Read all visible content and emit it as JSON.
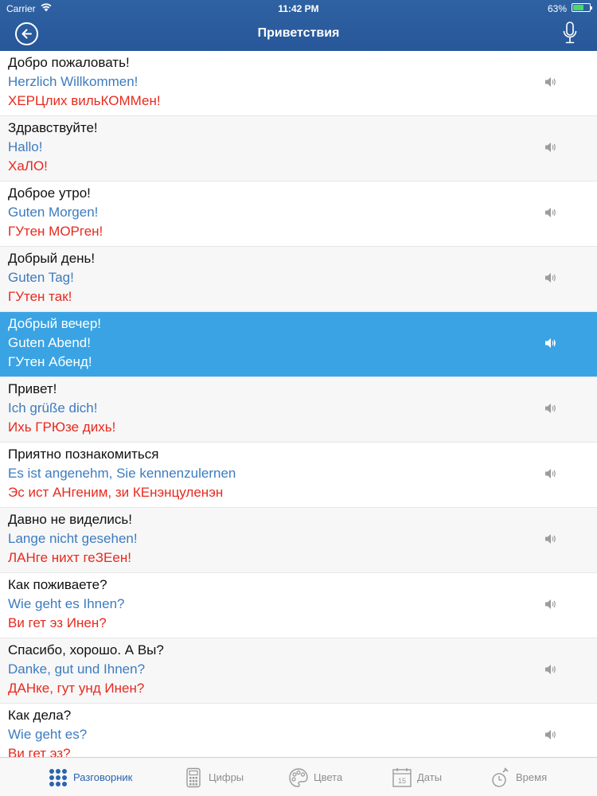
{
  "status_bar": {
    "carrier": "Carrier",
    "time": "11:42 PM",
    "battery": "63%",
    "battery_level": 0.63
  },
  "nav": {
    "title": "Приветствия",
    "back_icon": "back-arrow-circle-icon",
    "mic_icon": "microphone-icon"
  },
  "colors": {
    "header": "#2a5ea0",
    "selected_row": "#3aa3e3",
    "native_text": "#111111",
    "german_text": "#3d7bbf",
    "transcription_text": "#e8291f"
  },
  "phrases": [
    {
      "ru": "Добро пожаловать!",
      "de": "Herzlich Willkommen!",
      "tr": "ХЕРЦлих вильКОММен!"
    },
    {
      "ru": "Здравствуйте!",
      "de": "Hallo!",
      "tr": "ХаЛО!"
    },
    {
      "ru": "Доброе утро!",
      "de": "Guten Morgen!",
      "tr": "ГУтен МОРген!"
    },
    {
      "ru": "Добрый день!",
      "de": "Guten Tag!",
      "tr": "ГУтен так!"
    },
    {
      "ru": "Добрый вечер!",
      "de": "Guten Abend!",
      "tr": "ГУтен Абенд!",
      "selected": true
    },
    {
      "ru": "Привет!",
      "de": "Ich grüße dich!",
      "tr": "Ихь ГРЮзе дихь!"
    },
    {
      "ru": "Приятно познакомиться",
      "de": "Es ist angenehm, Sie kennenzulernen",
      "tr": "Эс ист АНгеним, зи КЕнэнцуленэн"
    },
    {
      "ru": "Давно не виделись!",
      "de": "Lange nicht gesehen!",
      "tr": "ЛАНге нихт геЗЕен!"
    },
    {
      "ru": "Как поживаете?",
      "de": "Wie geht es Ihnen?",
      "tr": "Ви гет эз Инен?"
    },
    {
      "ru": "Спасибо, хорошо. А Вы?",
      "de": "Danke, gut und Ihnen?",
      "tr": "ДАНке, гут унд Инен?"
    },
    {
      "ru": "Как дела?",
      "de": "Wie geht es?",
      "tr": "Ви гет эз?"
    }
  ],
  "tabs": [
    {
      "label": "Разговорник",
      "icon": "grid-dots-icon",
      "active": true
    },
    {
      "label": "Цифры",
      "icon": "calculator-icon",
      "active": false
    },
    {
      "label": "Цвета",
      "icon": "palette-icon",
      "active": false
    },
    {
      "label": "Даты",
      "icon": "calendar-icon",
      "active": false,
      "icon_text": "15"
    },
    {
      "label": "Время",
      "icon": "stopwatch-icon",
      "active": false
    }
  ]
}
